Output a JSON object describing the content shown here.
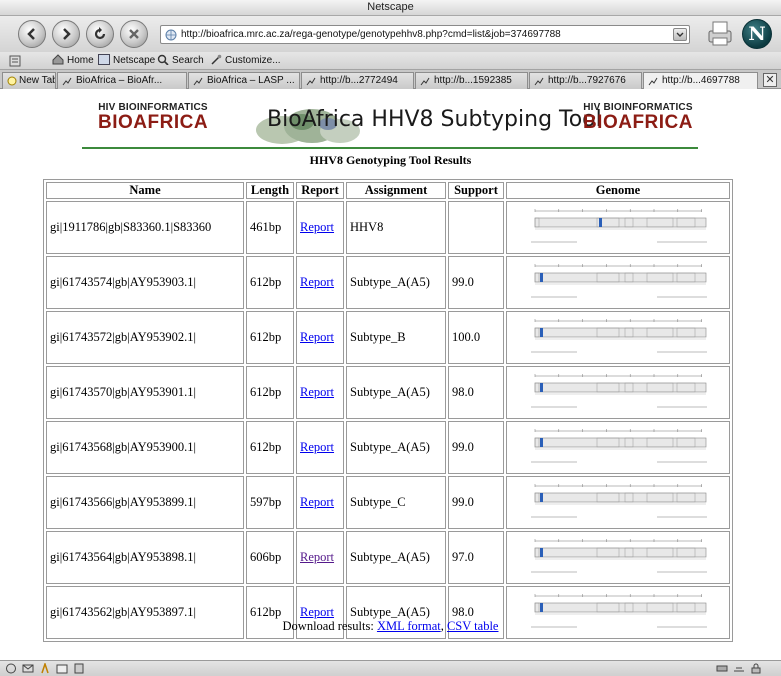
{
  "window": {
    "title": "Netscape"
  },
  "toolbar": {
    "url": "http://bioafrica.mrc.ac.za/rega-genotype/genotypehhv8.php?cmd=list&job=374697788"
  },
  "personal_toolbar": {
    "items": [
      "Home",
      "Netscape",
      "Search",
      "Customize..."
    ]
  },
  "tabs": {
    "new_tab": "New Tab",
    "items": [
      "BioAfrica – BioAfr...",
      "BioAfrica – LASP ...",
      "http://b...2772494",
      "http://b...1592385",
      "http://b...7927676",
      "http://b...4697788"
    ]
  },
  "banner": {
    "left_small": "HIV BIOINFORMATICS",
    "left_big": "BIOAFRICA",
    "title": "BioAfrica HHV8 Subtyping Tool",
    "right_small": "HIV BIOINFORMATICS",
    "right_big": "BIOAFRICA"
  },
  "page": {
    "title": "HHV8 Genotyping Tool Results"
  },
  "table": {
    "headers": [
      "Name",
      "Length",
      "Report",
      "Assignment",
      "Support",
      "Genome"
    ],
    "rows": [
      {
        "name": "gi|1911786|gb|S83360.1|S83360",
        "length": "461bp",
        "report": "Report",
        "assignment": "HHV8",
        "support": ""
      },
      {
        "name": "gi|61743574|gb|AY953903.1|",
        "length": "612bp",
        "report": "Report",
        "assignment": "Subtype_A(A5)",
        "support": "99.0"
      },
      {
        "name": "gi|61743572|gb|AY953902.1|",
        "length": "612bp",
        "report": "Report",
        "assignment": "Subtype_B",
        "support": "100.0"
      },
      {
        "name": "gi|61743570|gb|AY953901.1|",
        "length": "612bp",
        "report": "Report",
        "assignment": "Subtype_A(A5)",
        "support": "98.0"
      },
      {
        "name": "gi|61743568|gb|AY953900.1|",
        "length": "612bp",
        "report": "Report",
        "assignment": "Subtype_A(A5)",
        "support": "99.0"
      },
      {
        "name": "gi|61743566|gb|AY953899.1|",
        "length": "597bp",
        "report": "Report",
        "assignment": "Subtype_C",
        "support": "99.0"
      },
      {
        "name": "gi|61743564|gb|AY953898.1|",
        "length": "606bp",
        "report": "Report",
        "assignment": "Subtype_A(A5)",
        "support": "97.0"
      },
      {
        "name": "gi|61743562|gb|AY953897.1|",
        "length": "612bp",
        "report": "Report",
        "assignment": "Subtype_A(A5)",
        "support": "98.0"
      }
    ]
  },
  "download": {
    "label": "Download results:",
    "xml": "XML format",
    "separator": ",",
    "csv": "CSV table"
  },
  "colors": {
    "link": "#0000ee",
    "visited_link": "#551a8b",
    "bioafrica_red": "#8c1c14",
    "banner_line": "#3c8a3c"
  }
}
